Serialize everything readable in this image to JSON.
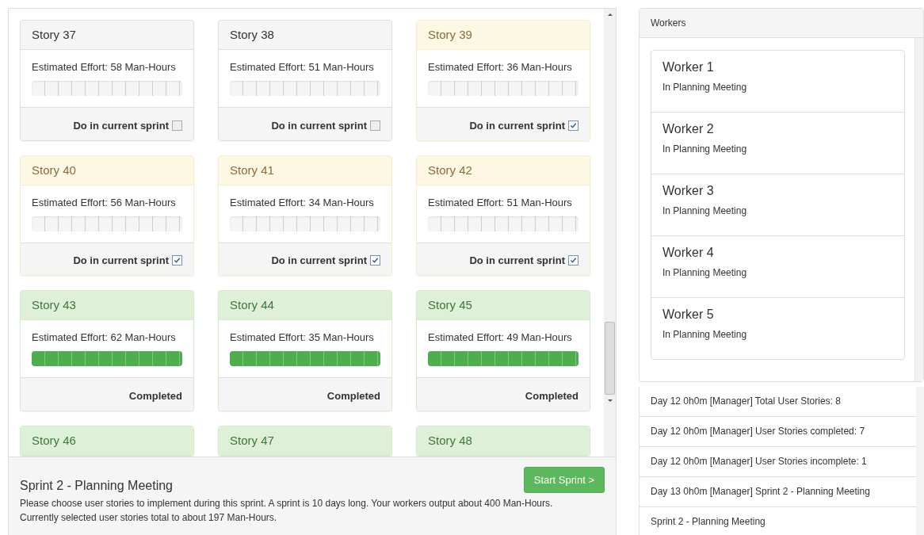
{
  "stories": [
    {
      "title": "Story 37",
      "effort": "Estimated Effort: 58 Man-Hours",
      "level": 0,
      "kind": "choice",
      "label": "Do in current sprint",
      "checked": false
    },
    {
      "title": "Story 38",
      "effort": "Estimated Effort: 51 Man-Hours",
      "level": 0,
      "kind": "choice",
      "label": "Do in current sprint",
      "checked": false
    },
    {
      "title": "Story 39",
      "effort": "Estimated Effort: 36 Man-Hours",
      "level": 0,
      "kind": "choice",
      "label": "Do in current sprint",
      "checked": true
    },
    {
      "title": "Story 40",
      "effort": "Estimated Effort: 56 Man-Hours",
      "level": 0,
      "kind": "choice",
      "label": "Do in current sprint",
      "checked": true
    },
    {
      "title": "Story 41",
      "effort": "Estimated Effort: 34 Man-Hours",
      "level": 0,
      "kind": "choice",
      "label": "Do in current sprint",
      "checked": true
    },
    {
      "title": "Story 42",
      "effort": "Estimated Effort: 51 Man-Hours",
      "level": 0,
      "kind": "choice",
      "label": "Do in current sprint",
      "checked": true
    },
    {
      "title": "Story 43",
      "effort": "Estimated Effort: 62 Man-Hours",
      "level": 1,
      "kind": "completed",
      "label": "Completed"
    },
    {
      "title": "Story 44",
      "effort": "Estimated Effort: 35 Man-Hours",
      "level": 1,
      "kind": "completed",
      "label": "Completed"
    },
    {
      "title": "Story 45",
      "effort": "Estimated Effort: 49 Man-Hours",
      "level": 1,
      "kind": "completed",
      "label": "Completed"
    },
    {
      "title": "Story 46",
      "kind": "completed"
    },
    {
      "title": "Story 47",
      "kind": "completed"
    },
    {
      "title": "Story 48",
      "kind": "completed"
    }
  ],
  "sprint": {
    "title": "Sprint 2 - Planning Meeting",
    "button": "Start Sprint >",
    "description": "Please choose user stories to implement during this sprint. A sprint is 10 days long. Your workers output about 400 Man-Hours. Currently selected user stories total to about 197 Man-Hours."
  },
  "workers": {
    "title": "Workers",
    "items": [
      {
        "name": "Worker 1",
        "status": "In Planning Meeting"
      },
      {
        "name": "Worker 2",
        "status": "In Planning Meeting"
      },
      {
        "name": "Worker 3",
        "status": "In Planning Meeting"
      },
      {
        "name": "Worker 4",
        "status": "In Planning Meeting"
      },
      {
        "name": "Worker 5",
        "status": "In Planning Meeting"
      }
    ]
  },
  "log": [
    "Day 12 0h0m [Manager] Total User Stories: 8",
    "Day 12 0h0m [Manager] User Stories completed: 7",
    "Day 12 0h0m [Manager] User Stories incomplete: 1",
    "Day 13 0h0m [Manager] Sprint 2 - Planning Meeting",
    "Sprint 2 - Planning Meeting"
  ]
}
